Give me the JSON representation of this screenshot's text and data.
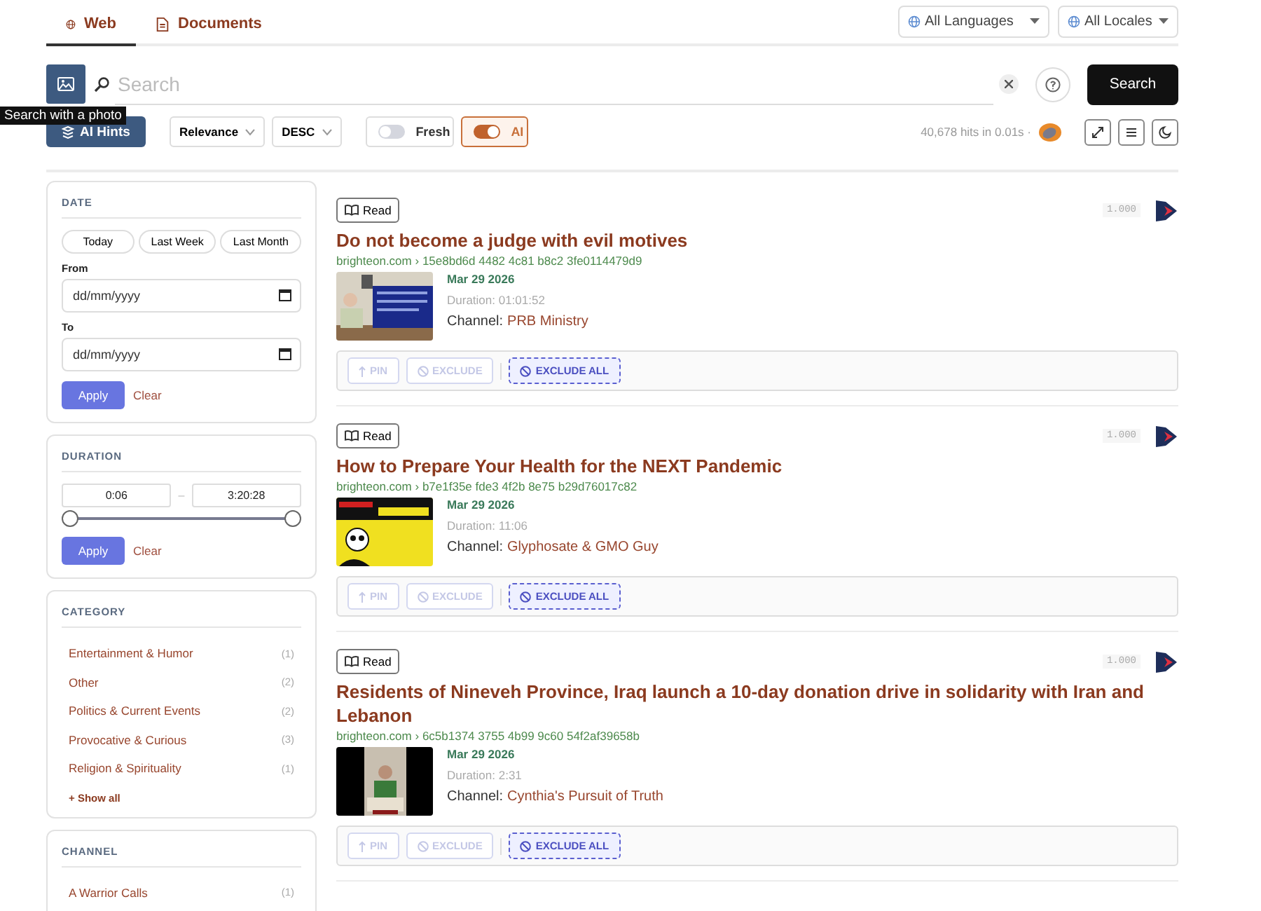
{
  "tabs": [
    {
      "label": "Web",
      "selected": true
    },
    {
      "label": "Documents",
      "selected": false
    }
  ],
  "selectors": [
    "All Languages",
    "All Locales"
  ],
  "search": {
    "placeholder": "Search",
    "button": "Search",
    "tooltip": "Search with a photo"
  },
  "toolbar": {
    "hints": "AI Hints",
    "sort": "Relevance",
    "order": "DESC",
    "toggles": [
      {
        "label": "Fresh",
        "on": false
      },
      {
        "label": "AI",
        "on": true
      }
    ],
    "stats": "40,678 hits in 0.01s ·"
  },
  "date_filter": {
    "title": "DATE",
    "presets": [
      "Today",
      "Last Week",
      "Last Month"
    ],
    "from_label": "From",
    "from_placeholder": "dd/mm/yyyy",
    "to_label": "To",
    "to_placeholder": "dd/mm/yyyy",
    "apply": "Apply",
    "clear": "Clear"
  },
  "duration_filter": {
    "title": "DURATION",
    "min": "0:06",
    "separator": "–",
    "max": "3:20:28",
    "low": {
      "level": 0
    },
    "high": {
      "level": 1
    },
    "apply": "Apply",
    "clear": "Clear"
  },
  "category_filter": {
    "title": "CATEGORY",
    "items": [
      {
        "label": "Entertainment & Humor",
        "count": "(1)"
      },
      {
        "label": "Other",
        "count": "(2)"
      },
      {
        "label": "Politics & Current Events",
        "count": "(2)"
      },
      {
        "label": "Provocative & Curious",
        "count": "(3)"
      },
      {
        "label": "Religion & Spirituality",
        "count": "(1)"
      }
    ],
    "more": "+ Show all"
  },
  "channel_filter": {
    "title": "CHANNEL",
    "items": [
      {
        "label": "A Warrior Calls",
        "count": "(1)"
      }
    ]
  },
  "results": [
    {
      "read": "Read",
      "score": "1.000",
      "title": "Do not become a judge with evil motives",
      "domain": "brighteon.com",
      "path": "› 15e8bd6d 4482 4c81 b8c2 3fe0114479d9",
      "date": "Mar 29 2026",
      "duration": "Duration: 01:01:52",
      "channel_label": "Channel:",
      "channel": "PRB Ministry",
      "actions": [
        "PIN",
        "EXCLUDE",
        "EXCLUDE ALL"
      ]
    },
    {
      "read": "Read",
      "score": "1.000",
      "title": "How to Prepare Your Health for the NEXT Pandemic",
      "domain": "brighteon.com",
      "path": "› b7e1f35e fde3 4f2b 8e75 b29d76017c82",
      "date": "Mar 29 2026",
      "duration": "Duration: 11:06",
      "channel_label": "Channel:",
      "channel": "Glyphosate & GMO Guy",
      "actions": [
        "PIN",
        "EXCLUDE",
        "EXCLUDE ALL"
      ]
    },
    {
      "read": "Read",
      "score": "1.000",
      "title": "Residents of Nineveh Province, Iraq launch a 10-day donation drive in solidarity with Iran and Lebanon",
      "domain": "brighteon.com",
      "path": "› 6c5b1374 3755 4b99 9c60 54f2af39658b",
      "date": "Mar 29 2026",
      "duration": "Duration: 2:31",
      "channel_label": "Channel:",
      "channel": "Cynthia's Pursuit of Truth",
      "actions": [
        "PIN",
        "EXCLUDE",
        "EXCLUDE ALL"
      ]
    }
  ]
}
